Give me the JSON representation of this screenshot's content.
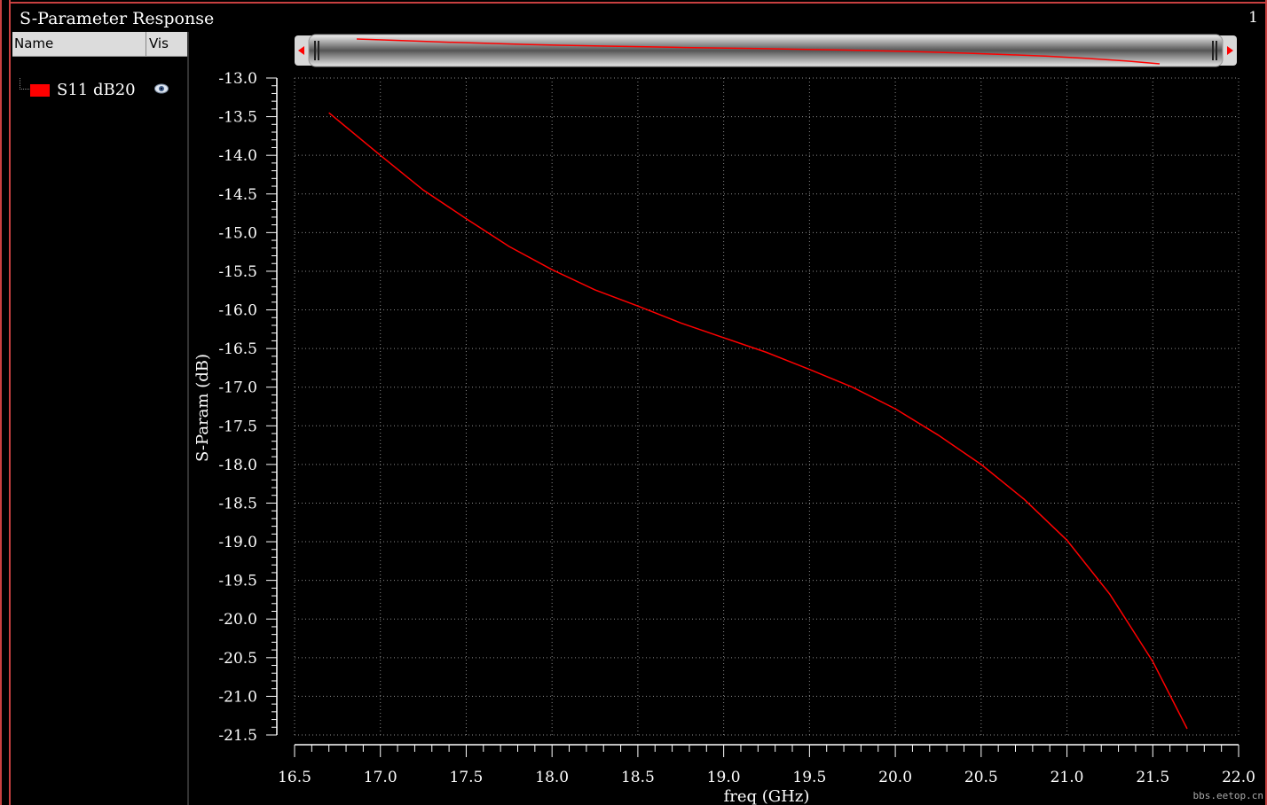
{
  "window": {
    "title": "S-Parameter Response",
    "subwindow_number": "1"
  },
  "legend": {
    "col_name": "Name",
    "col_vis": "Vis",
    "items": [
      {
        "label": "S11 dB20",
        "color": "#ff0000",
        "icon": "eye-icon"
      }
    ]
  },
  "watermark": "bbs.eetop.cn",
  "chart_data": {
    "type": "line",
    "title": "",
    "xlabel": "freq (GHz)",
    "ylabel": "S-Param (dB)",
    "xlim": [
      16.5,
      22.0
    ],
    "ylim": [
      -21.5,
      -13.0
    ],
    "x_ticks": [
      "16.5",
      "17.0",
      "17.5",
      "18.0",
      "18.5",
      "19.0",
      "19.5",
      "20.0",
      "20.5",
      "21.0",
      "21.5",
      "22.0"
    ],
    "y_ticks": [
      "-13.0",
      "-13.5",
      "-14.0",
      "-14.5",
      "-15.0",
      "-15.5",
      "-16.0",
      "-16.5",
      "-17.0",
      "-17.5",
      "-18.0",
      "-18.5",
      "-19.0",
      "-19.5",
      "-20.0",
      "-20.5",
      "-21.0",
      "-21.5"
    ],
    "grid": true,
    "series": [
      {
        "name": "S11 dB20",
        "color": "#ff0000",
        "x": [
          16.7,
          17.0,
          17.25,
          17.5,
          17.75,
          18.0,
          18.25,
          18.5,
          18.75,
          19.0,
          19.25,
          19.5,
          19.75,
          20.0,
          20.25,
          20.5,
          20.75,
          21.0,
          21.25,
          21.5,
          21.7
        ],
        "y": [
          -13.45,
          -14.0,
          -14.45,
          -14.82,
          -15.18,
          -15.48,
          -15.74,
          -15.95,
          -16.17,
          -16.36,
          -16.55,
          -16.77,
          -17.0,
          -17.28,
          -17.62,
          -18.0,
          -18.45,
          -18.98,
          -19.68,
          -20.55,
          -21.42
        ]
      }
    ]
  }
}
